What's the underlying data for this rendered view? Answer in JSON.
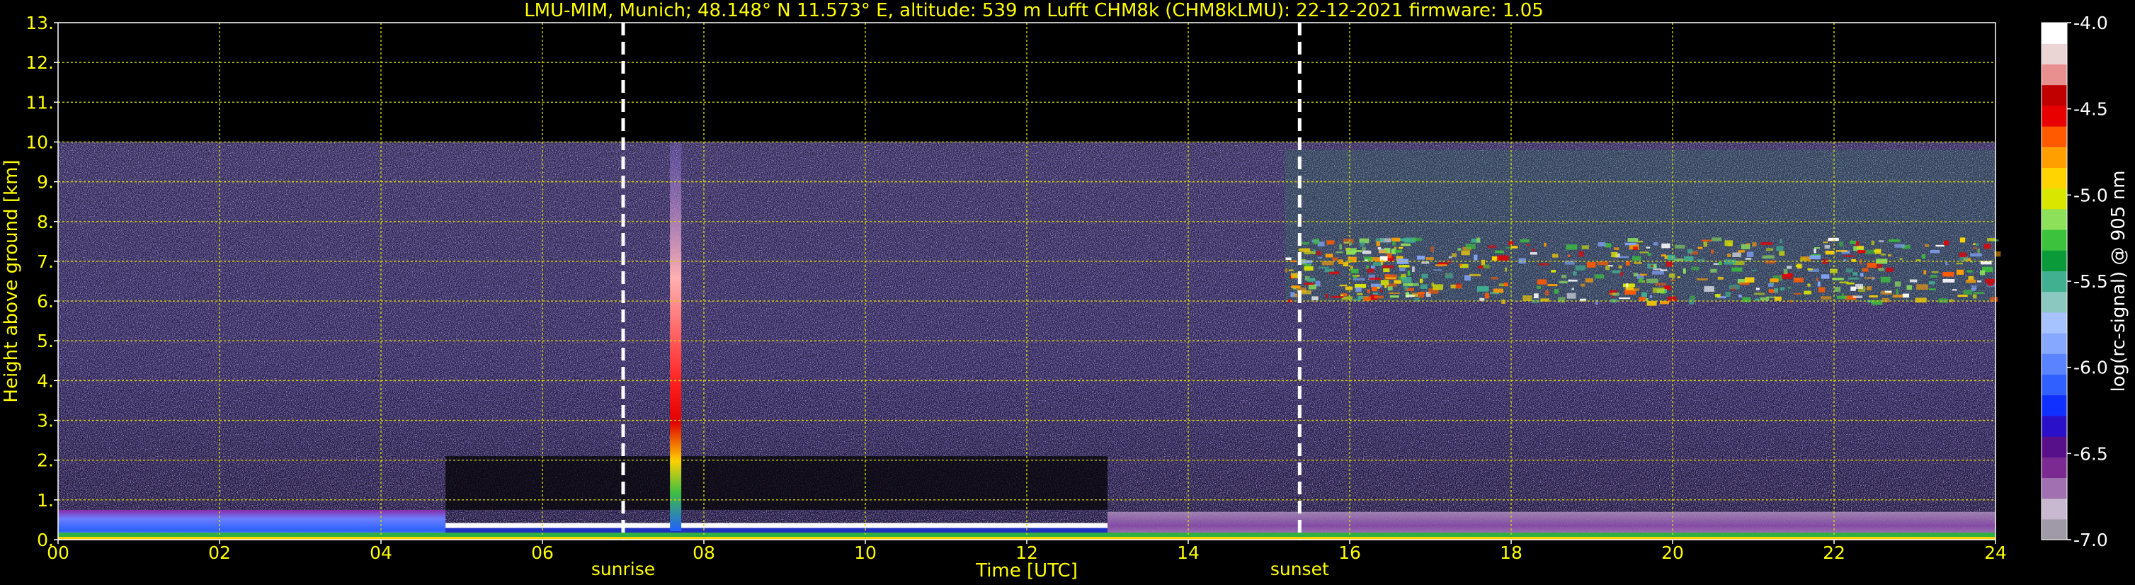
{
  "chart_data": {
    "type": "heatmap",
    "title": "LMU-MIM, Munich; 48.148° N 11.573° E, altitude: 539 m    Lufft CHM8k (CHM8kLMU): 22-12-2021    firmware: 1.05",
    "xlabel": "Time [UTC]",
    "ylabel": "Height above ground [km]",
    "xlim": [
      0,
      24
    ],
    "ylim": [
      0,
      13
    ],
    "x_ticks": [
      "00",
      "02",
      "04",
      "06",
      "08",
      "10",
      "12",
      "14",
      "16",
      "18",
      "20",
      "22",
      "24"
    ],
    "y_ticks": [
      "0.",
      "1.",
      "2.",
      "3.",
      "4.",
      "5.",
      "6.",
      "7.",
      "8.",
      "9.",
      "10.",
      "11.",
      "12.",
      "13."
    ],
    "grid": true,
    "data_top_km": 10,
    "colorbar": {
      "label": "log(rc-signal) @ 905 nm",
      "range": [
        -7.0,
        -4.0
      ],
      "ticks": [
        "-4.0",
        "-4.5",
        "-5.0",
        "-5.5",
        "-6.0",
        "-6.5",
        "-7.0"
      ],
      "tick_values": [
        -4.0,
        -4.5,
        -5.0,
        -5.5,
        -6.0,
        -6.5,
        -7.0
      ],
      "colors": [
        "#a09aa8",
        "#c8b8d0",
        "#a070b0",
        "#7a2a90",
        "#58108a",
        "#2a10c8",
        "#1030ff",
        "#3060ff",
        "#5a84ff",
        "#86a8ff",
        "#a6c2ff",
        "#8ac8c0",
        "#40b090",
        "#0a9a3a",
        "#3cc23c",
        "#8ce05a",
        "#d8e600",
        "#ffd400",
        "#ffa000",
        "#ff5a00",
        "#e80000",
        "#c00000",
        "#e89090",
        "#ead4d4",
        "#ffffff"
      ]
    },
    "annotations": [
      {
        "text": "sunrise",
        "x": 7.0
      },
      {
        "text": "sunset",
        "x": 15.38
      }
    ],
    "features": {
      "boundary_layer_top_km": 0.3,
      "residual_layer_top_km": 0.75,
      "precip_column": {
        "x": 7.65,
        "top_km": 10
      },
      "cloud_layer": {
        "x_start": 15.2,
        "x_end": 24,
        "base_km": 6.0,
        "top_km": 7.6
      }
    }
  }
}
